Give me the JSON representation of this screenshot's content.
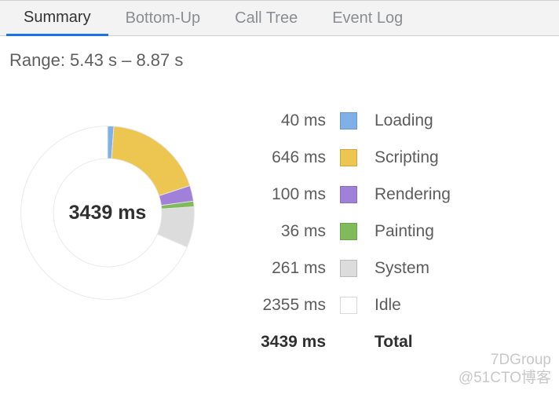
{
  "tabs": [
    {
      "label": "Summary",
      "active": true
    },
    {
      "label": "Bottom-Up",
      "active": false
    },
    {
      "label": "Call Tree",
      "active": false
    },
    {
      "label": "Event Log",
      "active": false
    }
  ],
  "range_label": "Range: 5.43 s – 8.87 s",
  "total_label": "3439 ms",
  "legend": [
    {
      "value": "40 ms",
      "label": "Loading",
      "color": "#7fb0e8"
    },
    {
      "value": "646 ms",
      "label": "Scripting",
      "color": "#edc652"
    },
    {
      "value": "100 ms",
      "label": "Rendering",
      "color": "#a080d8"
    },
    {
      "value": "36 ms",
      "label": "Painting",
      "color": "#80bb5b"
    },
    {
      "value": "261 ms",
      "label": "System",
      "color": "#dcdcdc"
    },
    {
      "value": "2355 ms",
      "label": "Idle",
      "color": "#ffffff"
    }
  ],
  "legend_total": {
    "value": "3439 ms",
    "label": "Total"
  },
  "watermark": {
    "line1": "7DGroup",
    "line2": "@51CTO博客"
  },
  "chart_data": {
    "type": "pie",
    "title": "",
    "categories": [
      "Loading",
      "Scripting",
      "Rendering",
      "Painting",
      "System",
      "Idle"
    ],
    "values": [
      40,
      646,
      100,
      36,
      261,
      2355
    ],
    "colors": [
      "#7fb0e8",
      "#edc652",
      "#a080d8",
      "#80bb5b",
      "#dcdcdc",
      "#ffffff"
    ],
    "total": 3439,
    "center_label": "3439 ms"
  }
}
